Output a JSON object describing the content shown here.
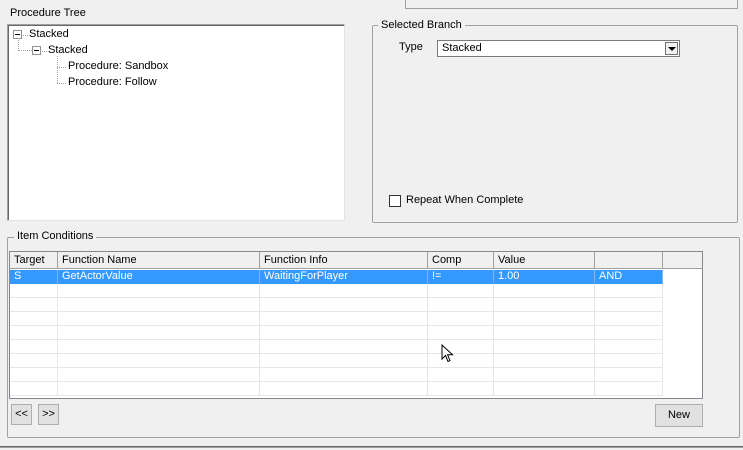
{
  "procedure_tree": {
    "label": "Procedure Tree",
    "nodes": [
      {
        "label": "Stacked",
        "level": 0,
        "expanded": true
      },
      {
        "label": "Stacked",
        "level": 1,
        "expanded": true
      },
      {
        "label": "Procedure: Sandbox",
        "level": 2
      },
      {
        "label": "Procedure: Follow",
        "level": 2
      }
    ]
  },
  "selected_branch": {
    "label": "Selected Branch",
    "type_label": "Type",
    "type_value": "Stacked",
    "repeat_label": "Repeat When Complete",
    "repeat_checked": false
  },
  "item_conditions": {
    "label": "Item Conditions",
    "columns": [
      "Target",
      "Function Name",
      "Function Info",
      "Comp",
      "Value",
      ""
    ],
    "rows": [
      {
        "target": "S",
        "function_name": "GetActorValue",
        "function_info": "WaitingForPlayer",
        "comp": "!=",
        "value": "1.00",
        "logic": "AND",
        "selected": true
      }
    ],
    "prev_label": "<<",
    "next_label": ">>",
    "new_label": "New"
  },
  "colors": {
    "selection": "#3399ff",
    "window_bg": "#f0f0f0"
  }
}
